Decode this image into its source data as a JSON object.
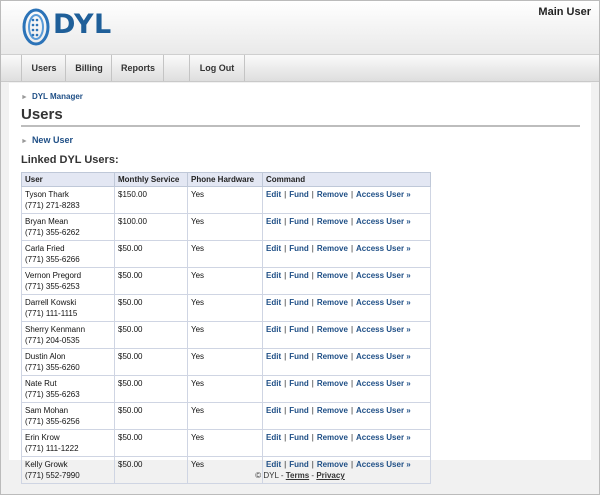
{
  "header": {
    "logo_text": "DYL",
    "user_label": "Main User"
  },
  "nav": {
    "items": [
      {
        "label": "Users"
      },
      {
        "label": "Billing"
      },
      {
        "label": "Reports"
      },
      {
        "label": ""
      },
      {
        "label": "Log Out"
      }
    ]
  },
  "breadcrumb": {
    "label": "DYL Manager"
  },
  "page": {
    "title": "Users",
    "new_user_label": "New User",
    "subtitle": "Linked DYL Users:"
  },
  "table": {
    "columns": [
      "User",
      "Monthly Service",
      "Phone Hardware",
      "Command"
    ],
    "commands": {
      "edit": "Edit",
      "fund": "Fund",
      "remove": "Remove",
      "access": "Access User »",
      "separator": "|"
    },
    "rows": [
      {
        "name": "Tyson Thark",
        "phone": "(771) 271-8283",
        "service": "$150.00",
        "hardware": "Yes"
      },
      {
        "name": "Bryan Mean",
        "phone": "(771) 355-6262",
        "service": "$100.00",
        "hardware": "Yes"
      },
      {
        "name": "Carla Fried",
        "phone": "(771) 355-6266",
        "service": "$50.00",
        "hardware": "Yes"
      },
      {
        "name": "Vernon Pregord",
        "phone": "(771) 355-6253",
        "service": "$50.00",
        "hardware": "Yes"
      },
      {
        "name": "Darrell Kowski",
        "phone": "(771) 111-1115",
        "service": "$50.00",
        "hardware": "Yes"
      },
      {
        "name": "Sherry Kenmann",
        "phone": "(771) 204-0535",
        "service": "$50.00",
        "hardware": "Yes"
      },
      {
        "name": "Dustin Alon",
        "phone": "(771) 355-6260",
        "service": "$50.00",
        "hardware": "Yes"
      },
      {
        "name": "Nate Rut",
        "phone": "(771) 355-6263",
        "service": "$50.00",
        "hardware": "Yes"
      },
      {
        "name": "Sam Mohan",
        "phone": "(771) 355-6256",
        "service": "$50.00",
        "hardware": "Yes"
      },
      {
        "name": "Erin Krow",
        "phone": "(771) 111-1222",
        "service": "$50.00",
        "hardware": "Yes"
      },
      {
        "name": "Kelly Growk",
        "phone": "(771) 552-7990",
        "service": "$50.00",
        "hardware": "Yes"
      }
    ]
  },
  "footer": {
    "copyright": "© DYL",
    "dash": "-",
    "terms": "Terms",
    "privacy": "Privacy"
  },
  "colors": {
    "link": "#1f4f86",
    "logo": "#1f5f99",
    "header_bg": "#e9e9e9",
    "table_header_bg": "#e3e7f3"
  }
}
